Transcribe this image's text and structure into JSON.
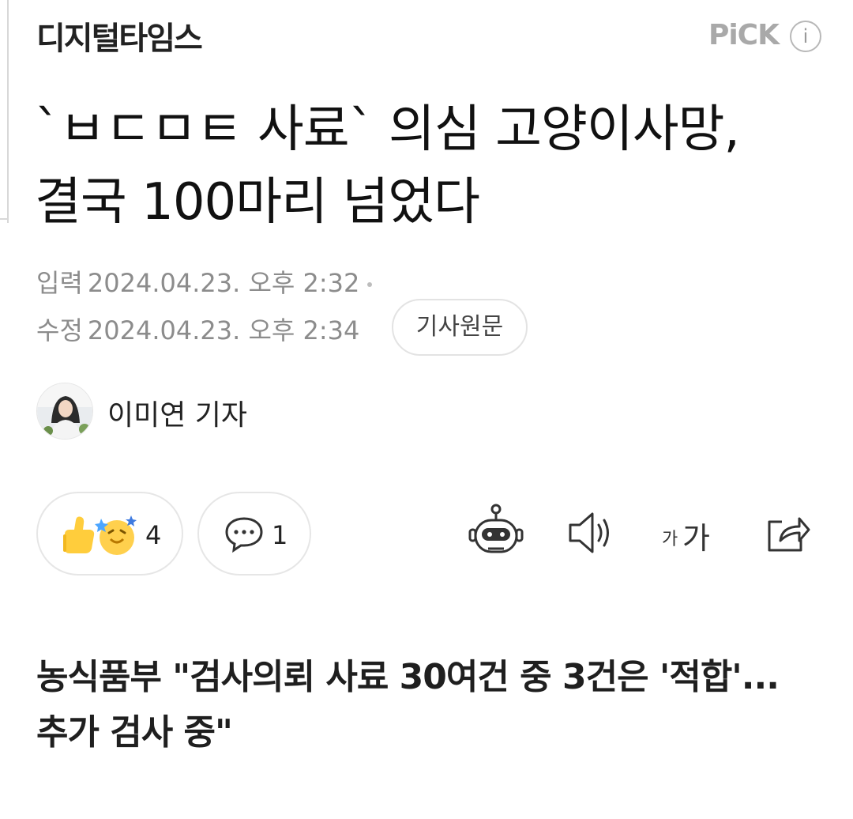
{
  "publisher": {
    "logo_text": "디지털타임스",
    "pick_label": "PiCK",
    "info_label": "i"
  },
  "article": {
    "title": "`ㅂㄷㅁㅌ 사료` 의심 고양이사망, 결국 100마리 넘었다",
    "published_label": "입력",
    "published_time": "2024.04.23. 오후 2:32",
    "modified_label": "수정",
    "modified_time": "2024.04.23. 오후 2:34",
    "original_button_label": "기사원문",
    "reporter": "이미연 기자",
    "subtitle": "농식품부 \"검사의뢰 사료 30여건 중 3건은 '적합'...추가 검사 중\""
  },
  "actions": {
    "reaction_count": "4",
    "comment_count": "1",
    "font_small": "가",
    "font_big": "가"
  },
  "icons": [
    "like-emoji-icon",
    "comment-icon",
    "robot-summary-icon",
    "speaker-icon",
    "font-size-icon",
    "share-icon",
    "info-icon"
  ],
  "colors": {
    "text": "#1a1a1a",
    "meta": "#8c8c8c",
    "pick": "#a9a9a9",
    "emoji_yellow": "#ffd04d",
    "border": "#e6e6e6"
  }
}
